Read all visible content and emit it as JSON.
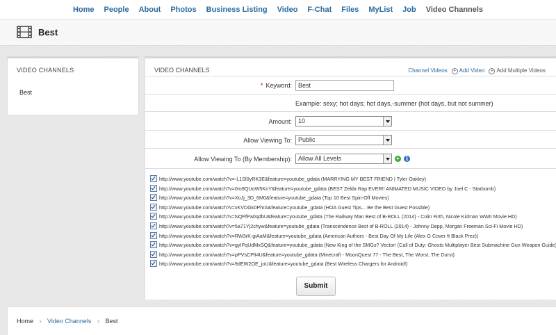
{
  "topnav": {
    "items": [
      "Home",
      "People",
      "About",
      "Photos",
      "Business Listing",
      "Video",
      "F-Chat",
      "Files",
      "MyList",
      "Job",
      "Video Channels"
    ]
  },
  "title": {
    "icon": "film-icon",
    "text": "Best"
  },
  "sidebar": {
    "header": "VIDEO CHANNELS",
    "items": [
      "Best"
    ]
  },
  "main": {
    "header": "VIDEO CHANNELS",
    "links": {
      "channel_videos": "Channel Videos",
      "add_video": "Add Video",
      "add_multiple": "Add Multiple Videos"
    },
    "form": {
      "keyword_label": "Keyword:",
      "keyword_value": "Best",
      "example": "Example: sexy; hot days; hot days,-summer (hot days, but not summer)",
      "amount_label": "Amount:",
      "amount_value": "10",
      "allow_label": "Allow Viewing To:",
      "allow_value": "Public",
      "membership_label": "Allow Viewing To (By Membership):",
      "membership_value": "Allow All Levels",
      "submit": "Submit"
    },
    "videos": [
      "http://www.youtube.com/watch?v=-L1Sl0yRK3E&feature=youtube_gdata (MARRYING MY BEST FRIEND | Tyler Oakley)",
      "http://www.youtube.com/watch?v=0m9QUoW5KnY&feature=youtube_gdata (BEST Zelda Rap EVER!! ANIMATED MUSIC VIDEO by Joel C - Starbomb)",
      "http://www.youtube.com/watch?v=XoJj_3D_6M0&feature=youtube_gdata (Top 10 Best Spin-Off Movies)",
      "http://www.youtube.com/watch?v=xKVDGk0PhrA&feature=youtube_gdata (HOA Guest Tips... Be the Best Guest Possible)",
      "http://www.youtube.com/watch?v=NQFfPa0qdbU&feature=youtube_gdata (The Railway Man Best of B-ROLL (2014) - Colin Firth, Nicole Kidman WWII Movie HD)",
      "http://www.youtube.com/watch?v=5a71Yj2chyw&feature=youtube_gdata (Transcendence Best of B-ROLL (2014) - Johnny Depp, Morgan Freeman Sci-Fi Movie HD)",
      "http://www.youtube.com/watch?v=RW3rK-giAaM&feature=youtube_gdata (American Authors - Best Day Of My Life (Alex G Cover ft Black Prez))",
      "http://www.youtube.com/watch?v=gyIPqUdMxSQ&feature=youtube_gdata (New King of the SMGs? Vector! (Call of Duty: Ghosts Multiplayer Best Submachine Gun Weapon Guide))",
      "http://www.youtube.com/watch?v=pPVsCPlt4U&feature=youtube_gdata (Minecraft - MoonQuest 77 - The Best, The Worst, The Durst)",
      "http://www.youtube.com/watch?v=9dEW2OE_joU&feature=youtube_gdata (Best Wireless Chargers for Android!)"
    ]
  },
  "breadcrumb": {
    "home": "Home",
    "section": "Video Channels",
    "current": "Best",
    "separator": "›"
  }
}
